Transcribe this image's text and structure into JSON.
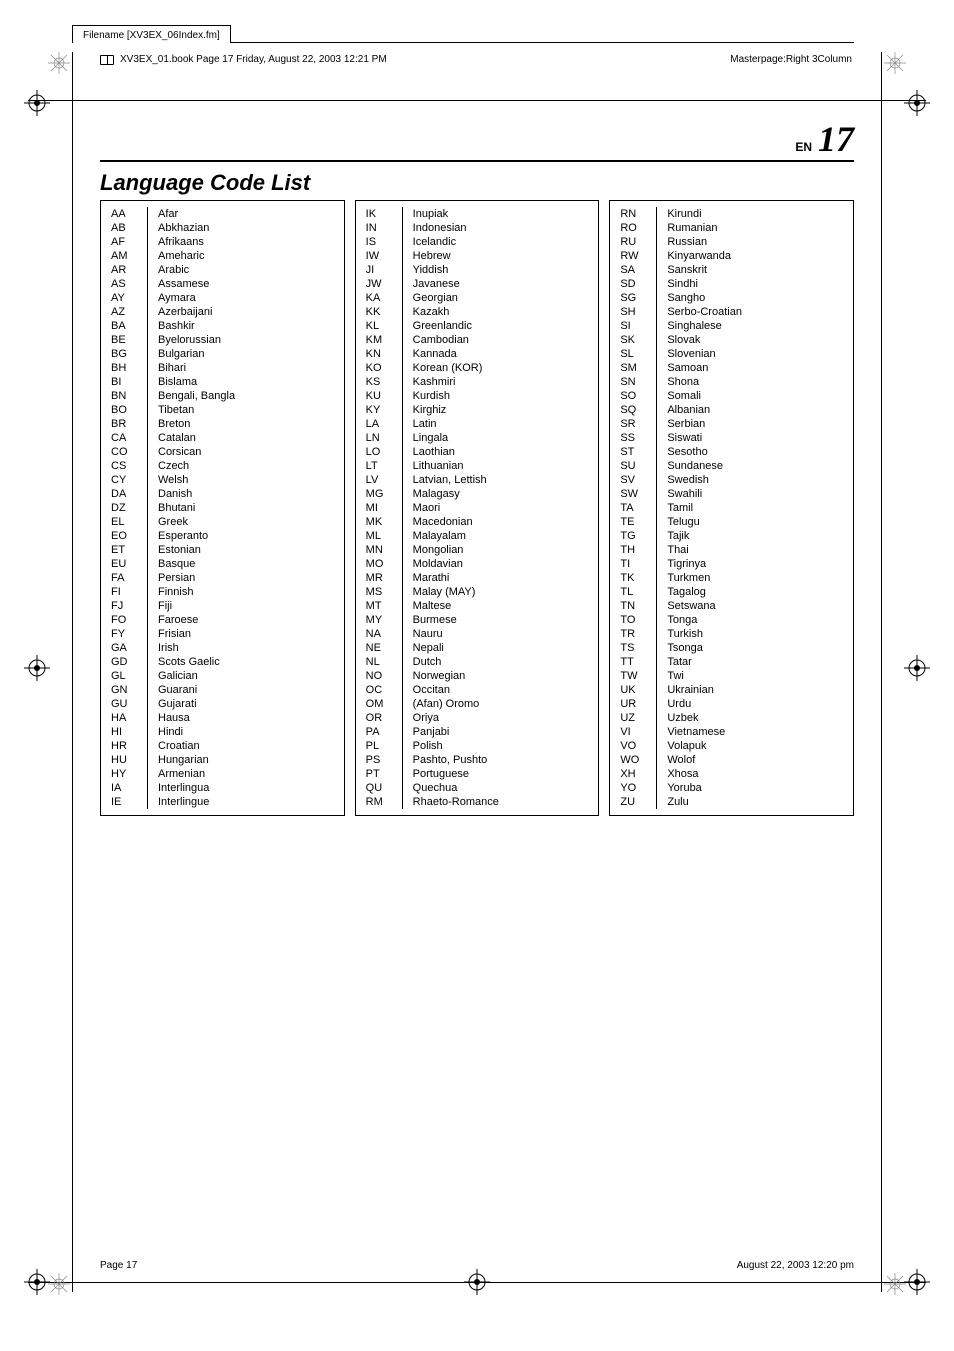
{
  "filename_label": "Filename [XV3EX_06Index.fm]",
  "bookline_left": "XV3EX_01.book  Page 17  Friday, August 22, 2003  12:21 PM",
  "bookline_right": "Masterpage:Right 3Column",
  "en_label": "EN",
  "page_number": "17",
  "title": "Language Code List",
  "footer_left": "Page 17",
  "footer_right": "August 22, 2003 12:20 pm",
  "columns": [
    [
      {
        "c": "AA",
        "l": "Afar"
      },
      {
        "c": "AB",
        "l": "Abkhazian"
      },
      {
        "c": "AF",
        "l": "Afrikaans"
      },
      {
        "c": "AM",
        "l": "Ameharic"
      },
      {
        "c": "AR",
        "l": "Arabic"
      },
      {
        "c": "AS",
        "l": "Assamese"
      },
      {
        "c": "AY",
        "l": "Aymara"
      },
      {
        "c": "AZ",
        "l": "Azerbaijani"
      },
      {
        "c": "BA",
        "l": "Bashkir"
      },
      {
        "c": "BE",
        "l": "Byelorussian"
      },
      {
        "c": "BG",
        "l": "Bulgarian"
      },
      {
        "c": "BH",
        "l": "Bihari"
      },
      {
        "c": "BI",
        "l": "Bislama"
      },
      {
        "c": "BN",
        "l": "Bengali, Bangla"
      },
      {
        "c": "BO",
        "l": "Tibetan"
      },
      {
        "c": "BR",
        "l": "Breton"
      },
      {
        "c": "CA",
        "l": "Catalan"
      },
      {
        "c": "CO",
        "l": "Corsican"
      },
      {
        "c": "CS",
        "l": "Czech"
      },
      {
        "c": "CY",
        "l": "Welsh"
      },
      {
        "c": "DA",
        "l": "Danish"
      },
      {
        "c": "DZ",
        "l": "Bhutani"
      },
      {
        "c": "EL",
        "l": "Greek"
      },
      {
        "c": "EO",
        "l": "Esperanto"
      },
      {
        "c": "ET",
        "l": "Estonian"
      },
      {
        "c": "EU",
        "l": "Basque"
      },
      {
        "c": "FA",
        "l": "Persian"
      },
      {
        "c": "FI",
        "l": "Finnish"
      },
      {
        "c": "FJ",
        "l": "Fiji"
      },
      {
        "c": "FO",
        "l": "Faroese"
      },
      {
        "c": "FY",
        "l": "Frisian"
      },
      {
        "c": "GA",
        "l": "Irish"
      },
      {
        "c": "GD",
        "l": "Scots Gaelic"
      },
      {
        "c": "GL",
        "l": "Galician"
      },
      {
        "c": "GN",
        "l": "Guarani"
      },
      {
        "c": "GU",
        "l": "Gujarati"
      },
      {
        "c": "HA",
        "l": "Hausa"
      },
      {
        "c": "HI",
        "l": "Hindi"
      },
      {
        "c": "HR",
        "l": "Croatian"
      },
      {
        "c": "HU",
        "l": "Hungarian"
      },
      {
        "c": "HY",
        "l": "Armenian"
      },
      {
        "c": "IA",
        "l": "Interlingua"
      },
      {
        "c": "IE",
        "l": "Interlingue"
      }
    ],
    [
      {
        "c": "IK",
        "l": "Inupiak"
      },
      {
        "c": "IN",
        "l": "Indonesian"
      },
      {
        "c": "IS",
        "l": "Icelandic"
      },
      {
        "c": "IW",
        "l": "Hebrew"
      },
      {
        "c": "JI",
        "l": "Yiddish"
      },
      {
        "c": "JW",
        "l": "Javanese"
      },
      {
        "c": "KA",
        "l": "Georgian"
      },
      {
        "c": "KK",
        "l": "Kazakh"
      },
      {
        "c": "KL",
        "l": "Greenlandic"
      },
      {
        "c": "KM",
        "l": "Cambodian"
      },
      {
        "c": "KN",
        "l": "Kannada"
      },
      {
        "c": "KO",
        "l": "Korean (KOR)"
      },
      {
        "c": "KS",
        "l": "Kashmiri"
      },
      {
        "c": "KU",
        "l": "Kurdish"
      },
      {
        "c": "KY",
        "l": "Kirghiz"
      },
      {
        "c": "LA",
        "l": "Latin"
      },
      {
        "c": "LN",
        "l": "Lingala"
      },
      {
        "c": "LO",
        "l": "Laothian"
      },
      {
        "c": "LT",
        "l": "Lithuanian"
      },
      {
        "c": "LV",
        "l": "Latvian, Lettish"
      },
      {
        "c": "MG",
        "l": "Malagasy"
      },
      {
        "c": "MI",
        "l": "Maori"
      },
      {
        "c": "MK",
        "l": "Macedonian"
      },
      {
        "c": "ML",
        "l": "Malayalam"
      },
      {
        "c": "MN",
        "l": "Mongolian"
      },
      {
        "c": "MO",
        "l": "Moldavian"
      },
      {
        "c": "MR",
        "l": "Marathi"
      },
      {
        "c": "MS",
        "l": "Malay (MAY)"
      },
      {
        "c": "MT",
        "l": "Maltese"
      },
      {
        "c": "MY",
        "l": "Burmese"
      },
      {
        "c": "NA",
        "l": "Nauru"
      },
      {
        "c": "NE",
        "l": "Nepali"
      },
      {
        "c": "NL",
        "l": "Dutch"
      },
      {
        "c": "NO",
        "l": "Norwegian"
      },
      {
        "c": "OC",
        "l": "Occitan"
      },
      {
        "c": "OM",
        "l": "(Afan) Oromo"
      },
      {
        "c": "OR",
        "l": "Oriya"
      },
      {
        "c": "PA",
        "l": "Panjabi"
      },
      {
        "c": "PL",
        "l": "Polish"
      },
      {
        "c": "PS",
        "l": "Pashto, Pushto"
      },
      {
        "c": "PT",
        "l": "Portuguese"
      },
      {
        "c": "QU",
        "l": "Quechua"
      },
      {
        "c": "RM",
        "l": "Rhaeto-Romance"
      }
    ],
    [
      {
        "c": "RN",
        "l": "Kirundi"
      },
      {
        "c": "RO",
        "l": "Rumanian"
      },
      {
        "c": "RU",
        "l": "Russian"
      },
      {
        "c": "RW",
        "l": "Kinyarwanda"
      },
      {
        "c": "SA",
        "l": "Sanskrit"
      },
      {
        "c": "SD",
        "l": "Sindhi"
      },
      {
        "c": "SG",
        "l": "Sangho"
      },
      {
        "c": "SH",
        "l": "Serbo-Croatian"
      },
      {
        "c": "SI",
        "l": "Singhalese"
      },
      {
        "c": "SK",
        "l": "Slovak"
      },
      {
        "c": "SL",
        "l": "Slovenian"
      },
      {
        "c": "SM",
        "l": "Samoan"
      },
      {
        "c": "SN",
        "l": "Shona"
      },
      {
        "c": "SO",
        "l": "Somali"
      },
      {
        "c": "SQ",
        "l": "Albanian"
      },
      {
        "c": "SR",
        "l": "Serbian"
      },
      {
        "c": "SS",
        "l": "Siswati"
      },
      {
        "c": "ST",
        "l": "Sesotho"
      },
      {
        "c": "SU",
        "l": "Sundanese"
      },
      {
        "c": "SV",
        "l": "Swedish"
      },
      {
        "c": "SW",
        "l": "Swahili"
      },
      {
        "c": "TA",
        "l": "Tamil"
      },
      {
        "c": "TE",
        "l": "Telugu"
      },
      {
        "c": "TG",
        "l": "Tajik"
      },
      {
        "c": "TH",
        "l": "Thai"
      },
      {
        "c": "TI",
        "l": "Tigrinya"
      },
      {
        "c": "TK",
        "l": "Turkmen"
      },
      {
        "c": "TL",
        "l": "Tagalog"
      },
      {
        "c": "TN",
        "l": "Setswana"
      },
      {
        "c": "TO",
        "l": "Tonga"
      },
      {
        "c": "TR",
        "l": "Turkish"
      },
      {
        "c": "TS",
        "l": "Tsonga"
      },
      {
        "c": "TT",
        "l": "Tatar"
      },
      {
        "c": "TW",
        "l": "Twi"
      },
      {
        "c": "UK",
        "l": "Ukrainian"
      },
      {
        "c": "UR",
        "l": "Urdu"
      },
      {
        "c": "UZ",
        "l": "Uzbek"
      },
      {
        "c": "VI",
        "l": "Vietnamese"
      },
      {
        "c": "VO",
        "l": "Volapuk"
      },
      {
        "c": "WO",
        "l": "Wolof"
      },
      {
        "c": "XH",
        "l": "Xhosa"
      },
      {
        "c": "YO",
        "l": "Yoruba"
      },
      {
        "c": "ZU",
        "l": "Zulu"
      }
    ]
  ]
}
